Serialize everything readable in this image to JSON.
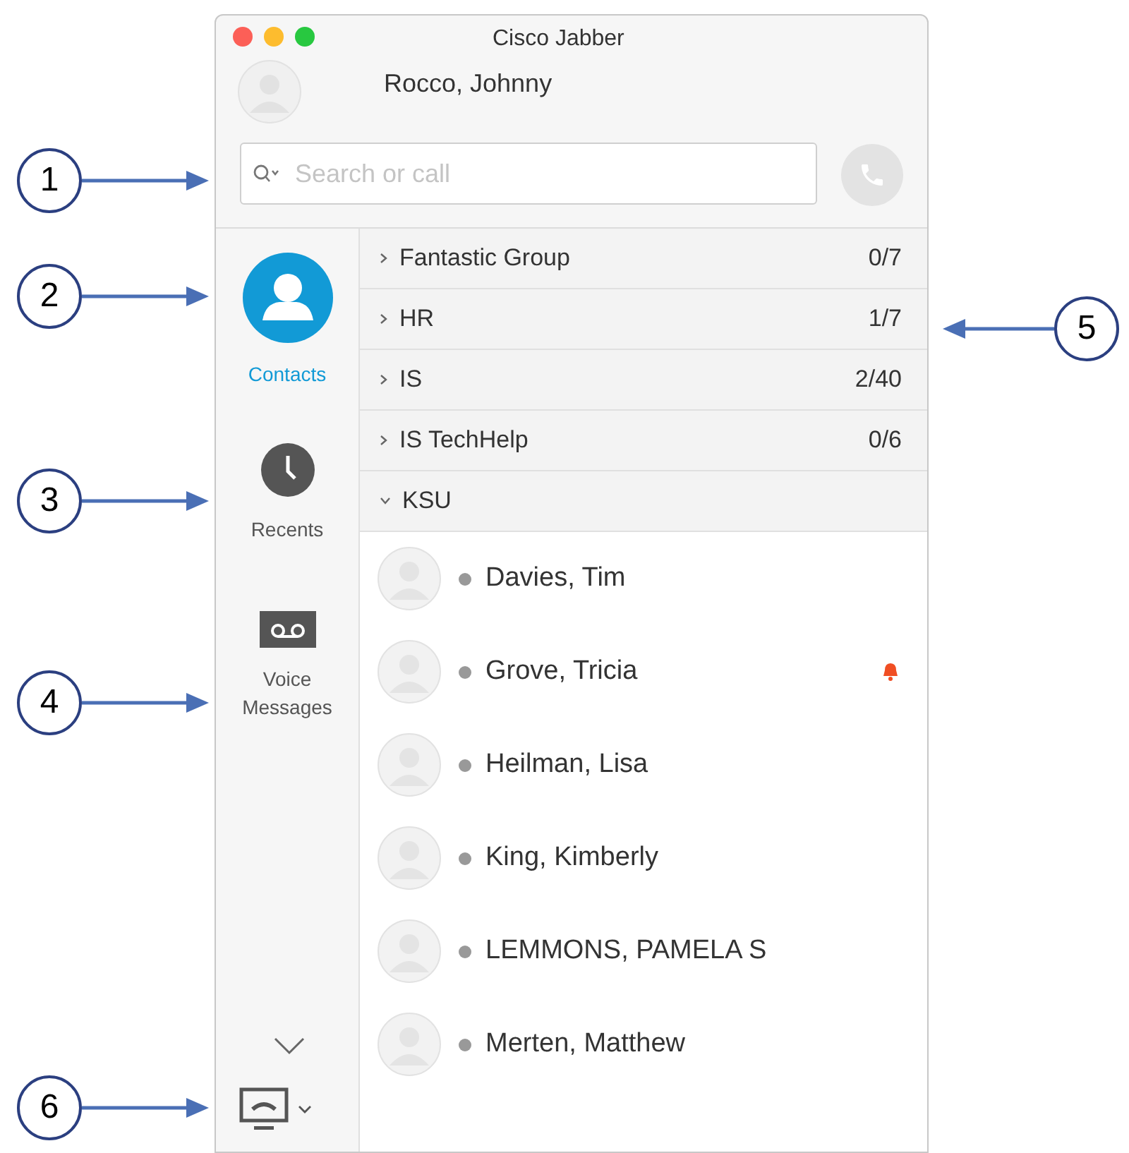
{
  "window": {
    "title": "Cisco Jabber"
  },
  "user": {
    "name": "Rocco, Johnny"
  },
  "search": {
    "placeholder": "Search or call"
  },
  "sidebar": {
    "items": [
      {
        "kind": "contacts",
        "label": "Contacts",
        "selected": true
      },
      {
        "kind": "recents",
        "label": "Recents",
        "selected": false
      },
      {
        "kind": "voicemail",
        "label": "Voice Messages",
        "selected": false
      }
    ]
  },
  "groups": [
    {
      "name": "Fantastic Group",
      "count": "0/7",
      "expanded": false
    },
    {
      "name": "HR",
      "count": "1/7",
      "expanded": false
    },
    {
      "name": "IS",
      "count": "2/40",
      "expanded": false
    },
    {
      "name": "IS TechHelp",
      "count": "0/6",
      "expanded": false
    },
    {
      "name": "KSU",
      "expanded": true,
      "contacts": [
        {
          "name": "Davies, Tim",
          "alert": false
        },
        {
          "name": "Grove, Tricia",
          "alert": true
        },
        {
          "name": "Heilman, Lisa",
          "alert": false
        },
        {
          "name": "King, Kimberly",
          "alert": false
        },
        {
          "name": "LEMMONS, PAMELA S",
          "alert": false
        },
        {
          "name": "Merten, Matthew",
          "alert": false
        }
      ]
    }
  ],
  "callouts": [
    {
      "label": "1",
      "kind": "right"
    },
    {
      "label": "2",
      "kind": "right"
    },
    {
      "label": "3",
      "kind": "right"
    },
    {
      "label": "4",
      "kind": "right"
    },
    {
      "label": "5",
      "kind": "left"
    },
    {
      "label": "6",
      "kind": "right"
    }
  ]
}
